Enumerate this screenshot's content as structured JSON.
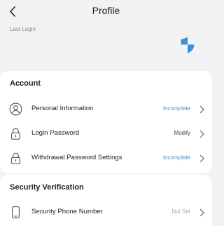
{
  "header": {
    "title": "Profile"
  },
  "hero": {
    "last_login_label": "Last Login"
  },
  "account": {
    "title": "Account",
    "items": [
      {
        "label": "Personal Information",
        "status": "Incomplete",
        "icon": "user-icon"
      },
      {
        "label": "Login Password",
        "status": "Modify",
        "icon": "lock-icon"
      },
      {
        "label": "Withdrawal Password Settings",
        "status": "Incomplete",
        "icon": "lock-icon"
      }
    ]
  },
  "security": {
    "title": "Security Verification",
    "items": [
      {
        "label": "Security Phone Number",
        "status": "Not Set",
        "icon": "phone-icon"
      }
    ]
  },
  "colors": {
    "background": "#f2f2f4",
    "card": "#ffffff",
    "accent": "#4a8fc4",
    "shield_blue": "#3d8fd6",
    "muted": "#a8a8ac"
  }
}
